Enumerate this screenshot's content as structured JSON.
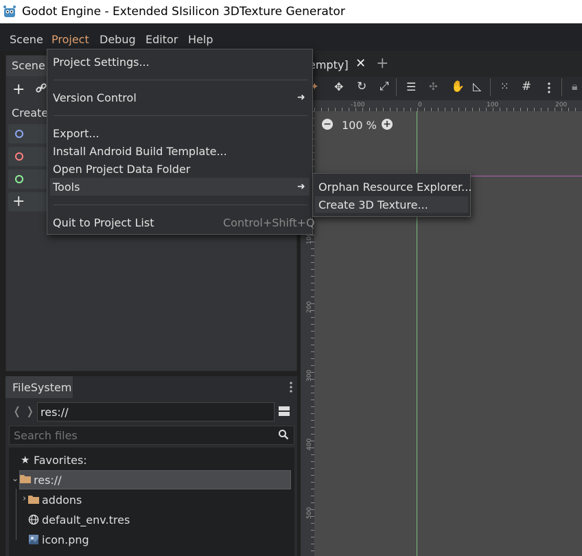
{
  "window": {
    "title": "Godot Engine - Extended SIsilicon 3DTexture Generator"
  },
  "menubar": {
    "items": [
      {
        "label": "Scene"
      },
      {
        "label": "Project"
      },
      {
        "label": "Debug"
      },
      {
        "label": "Editor"
      },
      {
        "label": "Help"
      }
    ],
    "active_color": "#e0a070"
  },
  "scene_dock": {
    "tab_label": "Scene",
    "create_root_label": "Create",
    "node_buttons": [
      {
        "icon": "node-2d-circle-icon",
        "color": "#8ea6f4"
      },
      {
        "icon": "spatial-circle-icon",
        "color": "#fc7f7f"
      },
      {
        "icon": "control-circle-icon",
        "color": "#8eef97"
      },
      {
        "icon": "plus-icon",
        "color": "#e0e0e0"
      }
    ]
  },
  "viewport": {
    "tab_label": "empty]",
    "zoom": "100 %",
    "ruler_top": [
      "-100",
      "0",
      "100",
      "200"
    ],
    "ruler_left": [
      "100",
      "200",
      "300",
      "400",
      "500"
    ]
  },
  "project_menu": {
    "project_settings": "Project Settings...",
    "version_control": "Version Control",
    "export": "Export...",
    "install_android": "Install Android Build Template...",
    "open_data_folder": "Open Project Data Folder",
    "tools": "Tools",
    "quit": "Quit to Project List",
    "quit_shortcut": "Control+Shift+Q"
  },
  "tools_submenu": {
    "orphan_explorer": "Orphan Resource Explorer...",
    "create_3d_texture": "Create 3D Texture..."
  },
  "filesystem": {
    "tab_label": "FileSystem",
    "path": "res://",
    "search_placeholder": "Search files",
    "favorites": "Favorites:",
    "root": "res://",
    "items": [
      {
        "label": "addons",
        "icon": "folder-icon"
      },
      {
        "label": "default_env.tres",
        "icon": "environment-icon"
      },
      {
        "label": "icon.png",
        "icon": "image-icon"
      }
    ]
  }
}
